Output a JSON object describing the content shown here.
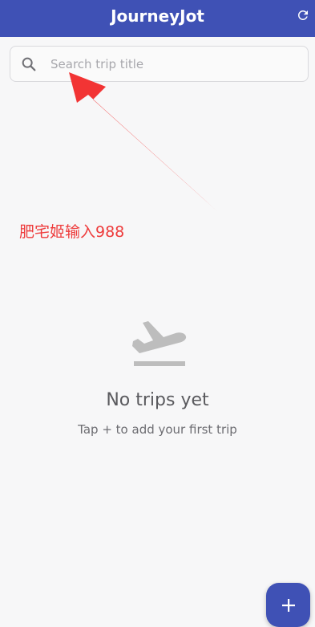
{
  "app": {
    "title": "JourneyJot",
    "bar_color": "#3f51b5",
    "refresh_icon": "refresh-icon"
  },
  "search": {
    "placeholder": "Search trip title",
    "value": "",
    "icon": "search-icon"
  },
  "annotation": {
    "text": "肥宅姬输入988",
    "color": "#ee3b3b"
  },
  "empty_state": {
    "icon": "flight-takeoff-icon",
    "title": "No trips yet",
    "subtitle": "Tap + to add your first trip"
  },
  "fab": {
    "icon": "add-icon"
  }
}
